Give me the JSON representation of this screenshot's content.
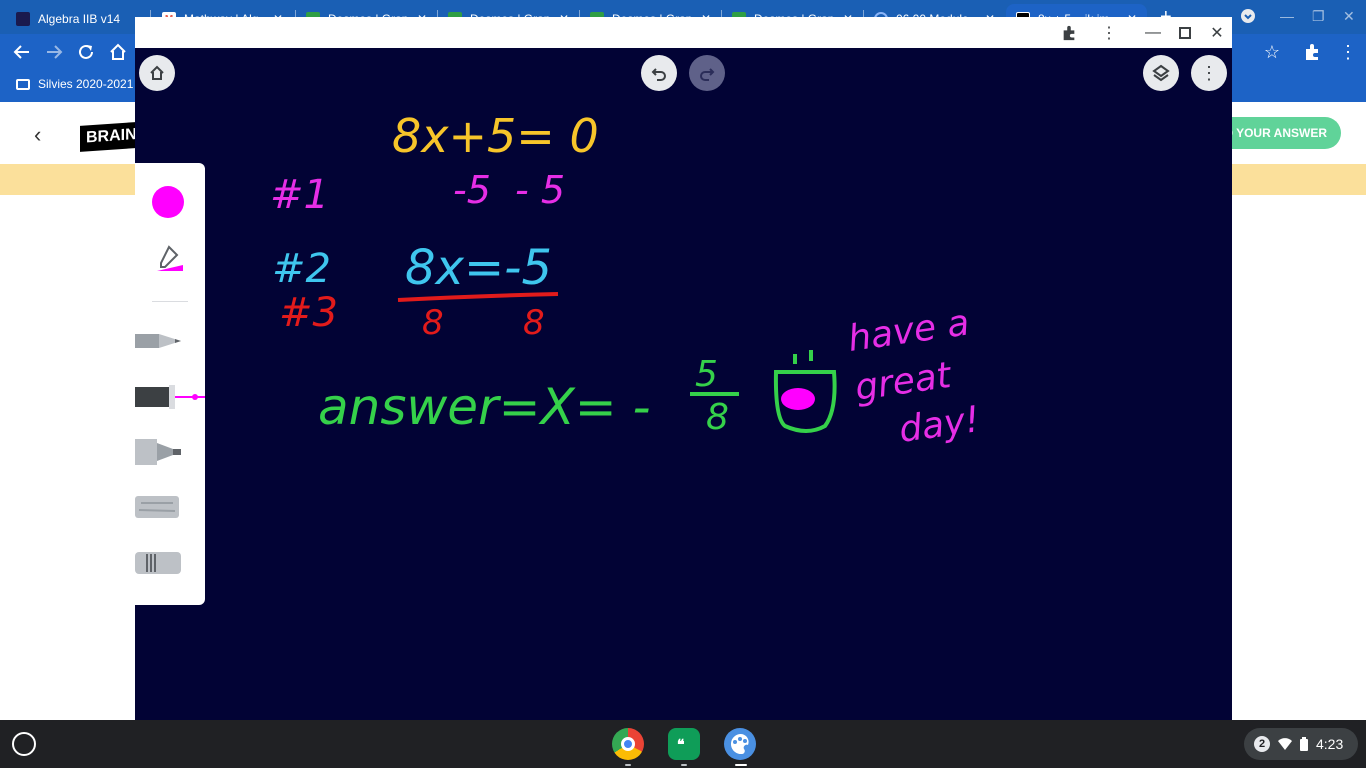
{
  "browser": {
    "tabs": [
      {
        "title": "Algebra IIB v14",
        "favicon_color": "#1a1a4e"
      },
      {
        "title": "Mathway | Alg",
        "favicon_color": "#e55b4d"
      },
      {
        "title": "Desmos | Grap",
        "favicon_color": "#2f9e44"
      },
      {
        "title": "Desmos | Grap",
        "favicon_color": "#2f9e44"
      },
      {
        "title": "Desmos | Grap",
        "favicon_color": "#2f9e44"
      },
      {
        "title": "Desmos | Grap",
        "favicon_color": "#2f9e44"
      },
      {
        "title": "06.00 Module",
        "favicon_color": "#1a5fb4"
      },
      {
        "title": "8x + 5 = ik im",
        "favicon_color": "#000000"
      }
    ],
    "new_tab_icon": "plus-icon",
    "bookmark": "Silvies 2020-2021"
  },
  "page": {
    "logo": "BRAIN",
    "answer_button": "D YOUR ANSWER"
  },
  "canvas": {
    "accent_color": "#ff00ff",
    "background": "#020335",
    "handwriting": {
      "equation_line1": "8x+5= 0",
      "step_subtract": "-5  - 5",
      "label1": "#1",
      "label2": "#2",
      "label3": "#3",
      "equation_line2": "8x=-5",
      "divisor_left": "8",
      "divisor_right": "8",
      "answer_text": "answer=X= -",
      "answer_num": "5",
      "answer_den": "8",
      "greeting_line1": "have a",
      "greeting_line2": "great",
      "greeting_line3": "day!"
    },
    "colors": {
      "yellow": "#f7c52a",
      "magenta": "#e62ee6",
      "cyan": "#3fc6ee",
      "red": "#e21b1b",
      "green": "#35d14a"
    }
  },
  "shelf": {
    "notification_count": "2",
    "time": "4:23"
  }
}
